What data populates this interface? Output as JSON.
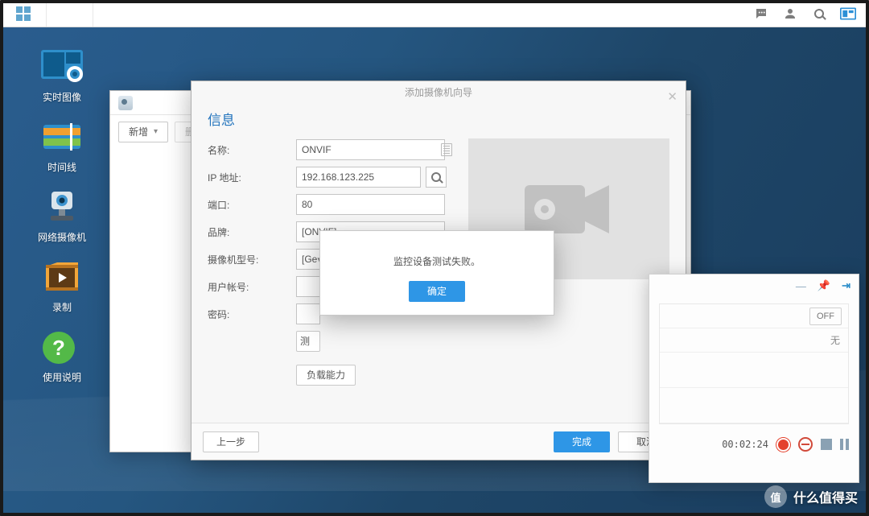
{
  "taskbar": {
    "tooltip_chat": "通知",
    "tooltip_user": "用户",
    "tooltip_search": "搜索",
    "tooltip_dash": "桌面小工具"
  },
  "desktop": [
    {
      "id": "live",
      "label": "实时图像"
    },
    {
      "id": "timeline",
      "label": "时间线"
    },
    {
      "id": "ipcam",
      "label": "网络摄像机"
    },
    {
      "id": "record",
      "label": "录制"
    },
    {
      "id": "help",
      "label": "使用说明"
    }
  ],
  "listwin": {
    "btn_new": "新增",
    "btn_del": "删"
  },
  "wizard": {
    "title": "添加摄像机向导",
    "section": "信息",
    "labels": {
      "name": "名称:",
      "ip": "IP 地址:",
      "port": "端口:",
      "brand": "品牌:",
      "model": "摄像机型号:",
      "user": "用户帐号:",
      "pass": "密码:"
    },
    "values": {
      "name": "ONVIF",
      "ip": "192.168.123.225",
      "port": "80",
      "brand": "[ONVIF]",
      "model": "[Ge",
      "user": "",
      "pass": ""
    },
    "btn_test": "测",
    "btn_load": "负载能力",
    "btn_prev": "上一步",
    "btn_finish": "完成",
    "btn_cancel": "取消"
  },
  "alert": {
    "message": "监控设备测试失败。",
    "ok": "确定"
  },
  "panel": {
    "off": "OFF",
    "none": "无",
    "time": "00:02:24"
  },
  "watermark": {
    "badge": "值",
    "text": "什么值得买"
  }
}
